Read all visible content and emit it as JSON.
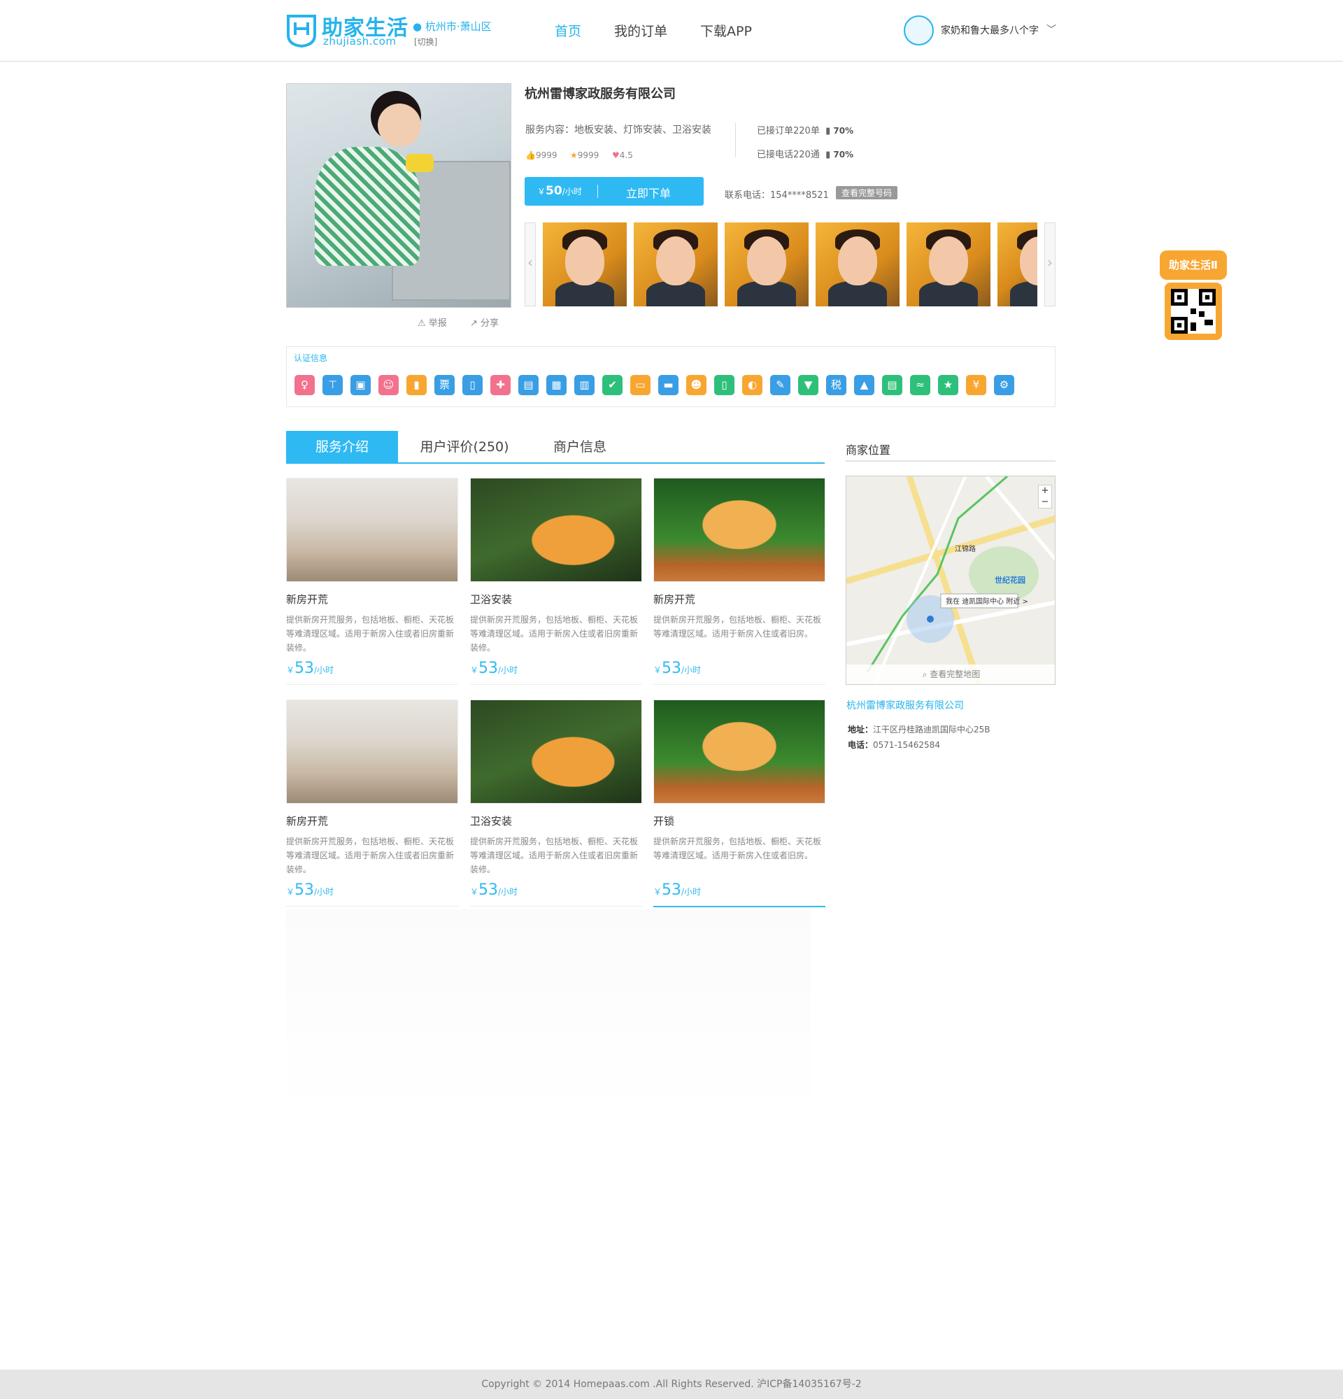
{
  "header": {
    "logo_cn": "助家生活",
    "logo_en": "zhujiash.com",
    "location": "杭州市·萧山区",
    "location_switch": "[切换]",
    "nav": [
      "首页",
      "我的订单",
      "下载APP"
    ],
    "username": "家奶和鲁大最多八个字"
  },
  "profile": {
    "company": "杭州雷博家政服务有限公司",
    "service_content": "服务内容：地板安装、灯饰安装、卫浴安装",
    "likes": "9999",
    "stars": "9999",
    "hearts": "4.5",
    "orders_label": "已接订单220单",
    "orders_rate": "70%",
    "calls_label": "已接电话220通",
    "calls_rate": "70%",
    "price_symbol": "￥",
    "price": "50",
    "price_unit": "/小时",
    "order_button": "立即下单",
    "contact": "联系电话：154****8521",
    "contact_button": "查看完整号码",
    "report": "举报",
    "share": "分享",
    "gallery_count": 6
  },
  "cert": {
    "title": "认证信息",
    "icons": [
      {
        "name": "guard-icon",
        "color": "#f2728e",
        "glyph": "♀"
      },
      {
        "name": "org-chart-icon",
        "color": "#3a9ee4",
        "glyph": "⊤"
      },
      {
        "name": "id-card-icon",
        "color": "#3a9ee4",
        "glyph": "▣"
      },
      {
        "name": "nanny-icon",
        "color": "#f2728e",
        "glyph": "☺"
      },
      {
        "name": "bottle-icon",
        "color": "#f8a632",
        "glyph": "▮"
      },
      {
        "name": "ticket-icon",
        "color": "#3a9ee4",
        "glyph": "票"
      },
      {
        "name": "phone-icon",
        "color": "#3a9ee4",
        "glyph": "▯"
      },
      {
        "name": "medical-icon",
        "color": "#f2728e",
        "glyph": "✚"
      },
      {
        "name": "certificate-icon",
        "color": "#3a9ee4",
        "glyph": "▤"
      },
      {
        "name": "license-icon",
        "color": "#3a9ee4",
        "glyph": "▦"
      },
      {
        "name": "profile-card-icon",
        "color": "#3a9ee4",
        "glyph": "▥"
      },
      {
        "name": "person-check-icon",
        "color": "#2ec07a",
        "glyph": "✔"
      },
      {
        "name": "box-icon",
        "color": "#f8a632",
        "glyph": "▭"
      },
      {
        "name": "briefcase-icon",
        "color": "#3a9ee4",
        "glyph": "▬"
      },
      {
        "name": "worker-icon",
        "color": "#f8a632",
        "glyph": "☻"
      },
      {
        "name": "battery-icon",
        "color": "#2ec07a",
        "glyph": "▯"
      },
      {
        "name": "gear-split-icon",
        "color": "#f8a632",
        "glyph": "◐"
      },
      {
        "name": "wrench-icon",
        "color": "#3a9ee4",
        "glyph": "✎"
      },
      {
        "name": "bucket-icon",
        "color": "#2ec07a",
        "glyph": "▼"
      },
      {
        "name": "tax-icon",
        "color": "#3a9ee4",
        "glyph": "税"
      },
      {
        "name": "lock-icon",
        "color": "#3a9ee4",
        "glyph": "▲"
      },
      {
        "name": "card-reader-icon",
        "color": "#2ec07a",
        "glyph": "▤"
      },
      {
        "name": "handshake-icon",
        "color": "#2ec07a",
        "glyph": "≈"
      },
      {
        "name": "star-badge-icon",
        "color": "#2ec07a",
        "glyph": "★"
      },
      {
        "name": "yuan-icon",
        "color": "#f8a632",
        "glyph": "¥"
      },
      {
        "name": "settings-icon",
        "color": "#3a9ee4",
        "glyph": "⚙"
      }
    ]
  },
  "tabs": [
    {
      "label": "服务介绍"
    },
    {
      "label": "用户评价(250)"
    },
    {
      "label": "商户信息"
    }
  ],
  "services": [
    {
      "title": "新房开荒",
      "desc": "提供新房开荒服务，包括地板、橱柜、天花板等难清理区域。适用于新房入住或者旧房重新装修。",
      "price": "53",
      "unit": "/小时",
      "img": "kitten-playing"
    },
    {
      "title": "卫浴安装",
      "desc": "提供新房开荒服务，包括地板、橱柜、天花板等难清理区域。适用于新房入住或者旧房重新装修。",
      "price": "53",
      "unit": "/小时",
      "img": "orange-kitten"
    },
    {
      "title": "新房开荒",
      "desc": "提供新房开荒服务，包括地板、橱柜、天花板等难清理区域。适用于新房入住或者旧房。",
      "price": "53",
      "unit": "/小时",
      "img": "kitten-pot"
    },
    {
      "title": "新房开荒",
      "desc": "提供新房开荒服务，包括地板、橱柜、天花板等难清理区域。适用于新房入住或者旧房重新装修。",
      "price": "53",
      "unit": "/小时",
      "img": "kitten-playing"
    },
    {
      "title": "卫浴安装",
      "desc": "提供新房开荒服务，包括地板、橱柜、天花板等难清理区域。适用于新房入住或者旧房重新装修。",
      "price": "53",
      "unit": "/小时",
      "img": "orange-kitten"
    },
    {
      "title": "开锁",
      "desc": "提供新房开荒服务，包括地板、橱柜、天花板等难清理区域。适用于新房入住或者旧房。",
      "price": "53",
      "unit": "/小时",
      "img": "kitten-pot"
    }
  ],
  "price_symbol": "￥",
  "sidebar": {
    "title": "商家位置",
    "map_view_full": "查看完整地图",
    "map_labels": {
      "road": "江锦路",
      "garden": "世纪花园",
      "here": "我在 迪凯国际中心 附近 >",
      "zoom_in": "+",
      "zoom_out": "−"
    },
    "merchant_name": "杭州雷博家政服务有限公司",
    "address_label": "地址：",
    "address": "江干区丹桂路迪凯国际中心25B",
    "phone_label": "电话：",
    "phone": "0571-15462584"
  },
  "qr_widget": {
    "label": "助家生活Ⅱ"
  },
  "footer": {
    "copyright": "Copyright © 2014 Homepaas.com .All Rights Reserved. 沪ICP备14035167号-2"
  }
}
